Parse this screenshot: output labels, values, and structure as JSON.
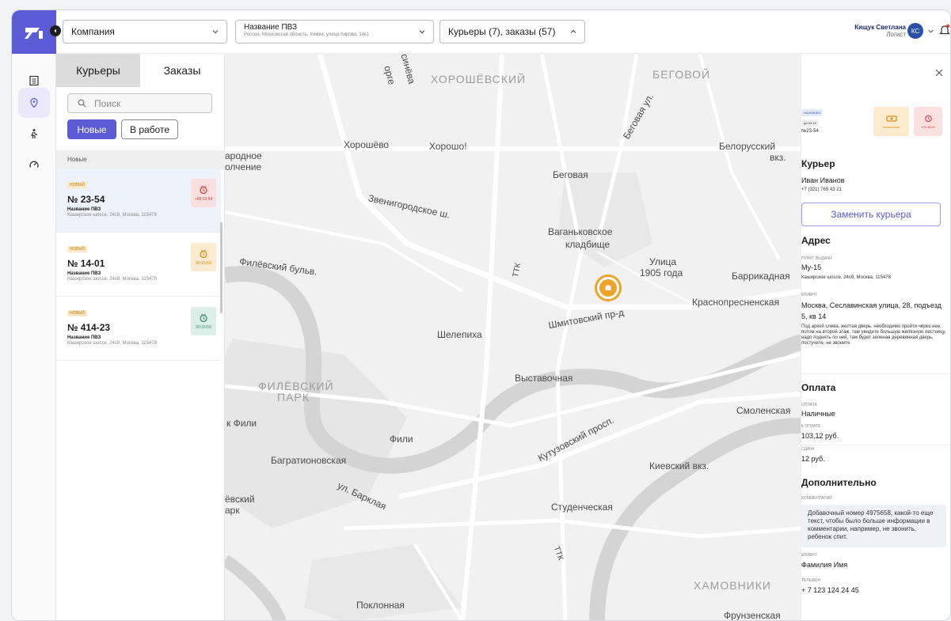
{
  "topbar": {
    "company_select": "Компания",
    "pvz_select_title": "Название ПВЗ",
    "pvz_select_address": "Россия, Московская область, Химки, улица Кирова, 10к1",
    "summary_select": "Курьеры (7), заказы (57)",
    "user_name": "Кищук Светлана",
    "user_role": "Логист",
    "avatar_initials": "КС"
  },
  "panel": {
    "tab_couriers": "Курьеры",
    "tab_orders": "Заказы",
    "search_placeholder": "Поиск",
    "filter_new": "Новые",
    "filter_in_work": "В работе",
    "group_title": "Новые",
    "cards": [
      {
        "badge": "новый",
        "number": "№ 23-54",
        "pvz": "Название ПВЗ",
        "address": "Каширское шоссе, 24с8, Москва, 115478",
        "timer": "+00:10:54",
        "timer_color": "red"
      },
      {
        "badge": "новый",
        "number": "№ 14-01",
        "pvz": "Название ПВЗ",
        "address": "Каширское шоссе, 24с8, Москва, 115478",
        "timer": "00:15:59",
        "timer_color": "orange"
      },
      {
        "badge": "новый",
        "number": "№ 414-23",
        "pvz": "Название ПВЗ",
        "address": "Каширское шоссе, 24с8, Москва, 115478",
        "timer": "00:15:59",
        "timer_color": "green"
      }
    ]
  },
  "map": {
    "labels": {
      "khoroshevsky": "ХОРОШЁВСКИЙ",
      "begovoy": "БЕГОВОЙ",
      "begovaya_ul": "Беговая ул.",
      "khoroshyovo": "Хорошёво",
      "khorosho": "Хорошо!",
      "belorussky": "Белорусский",
      "vkz1": "вкз.",
      "narodnoe": "ародное",
      "opolchenie": "олчение",
      "begovaya": "Беговая",
      "zvenigorodskoe": "Звенигородское ш.",
      "vagankovskoe": "Ваганьковское",
      "kladbishche": "кладбище",
      "ulitsa1905": "Улица",
      "goda1905": "1905 года",
      "barrikadnaya": "Баррикадная",
      "filevsky_bulvar": "Филёвский бульв.",
      "ttk": "ТТК",
      "krasnopresnenskaya": "Краснопресненская",
      "shmitovsky": "Шмитовский пр-д",
      "shelepikha": "Шелепиха",
      "vystavochnaya": "Выставочная",
      "filevsky_park1": "ФИЛЁВСКИЙ",
      "filevsky_park2": "ПАРК",
      "k_fili": "к Фили",
      "fili": "Фили",
      "smolenskaya": "Смоленская",
      "kutuzovsky": "Кутузовский просп.",
      "bagrationovskaya": "Багратионовская",
      "kievsky": "Киевский вкз.",
      "evsky": "ёвский",
      "ark": "арк",
      "barklaya": "ул. Барклая",
      "studencheskaya": "Студенческая",
      "ttk2": "ТТК",
      "poklonnaya": "Поклонная",
      "khamovniki": "ХАМОВНИКИ",
      "frunzenskaya": "Фрунзенская",
      "rge": "орге",
      "sinitsa": "синёва"
    }
  },
  "detail": {
    "status_badge": "назначен",
    "deadline_badge": "до 23:15",
    "order_number": "№23-54",
    "payment_tag": "Наличными",
    "timer_tag": "+00:10:54",
    "courier_heading": "Курьер",
    "courier_name": "Иван Иванов",
    "courier_phone": "+7 (321) 765 43 21",
    "replace_button": "Заменить курьера",
    "address_heading": "Адрес",
    "pickup_label": "пункт выдачи",
    "pickup_name": "Му-15",
    "pickup_address": "Каширское шоссе, 24с8, Москва, 115478",
    "client_label": "клиент",
    "client_address": "Москва, Сеславинская улица, 28, подъезд 5, кв 14",
    "client_note": "Под аркой слева, желтая дверь, необходимо пройти через нее, потом на второй этаж, там увидите большую железную лестницу, надо поднять по ней, там будет зеленая деревянная дверь, постучите, не звоните",
    "payment_heading": "Оплата",
    "payment_label": "оплата",
    "payment_value": "Наличные",
    "to_pay_label": "к оплате",
    "to_pay_value": "103,12 руб.",
    "change_label": "сдача",
    "change_value": "12 руб.",
    "extra_heading": "Дополнительно",
    "comment_label": "комментарий",
    "comment_text": "Добавочный номер 4975658, какой-то еще текст, чтобы было больше информации в комментарии, например, не звонить, ребенок спит.",
    "client2_label": "клиент",
    "client2_value": "Фамилия Имя",
    "phone_label": "телефон",
    "phone_value": "+ 7 123 124 24 45"
  },
  "colors": {
    "accent": "#5b5bd6",
    "pin": "#f0a32b",
    "timer_red": "#d83b3b",
    "timer_orange": "#d9890f",
    "timer_green": "#2a8f6a"
  }
}
